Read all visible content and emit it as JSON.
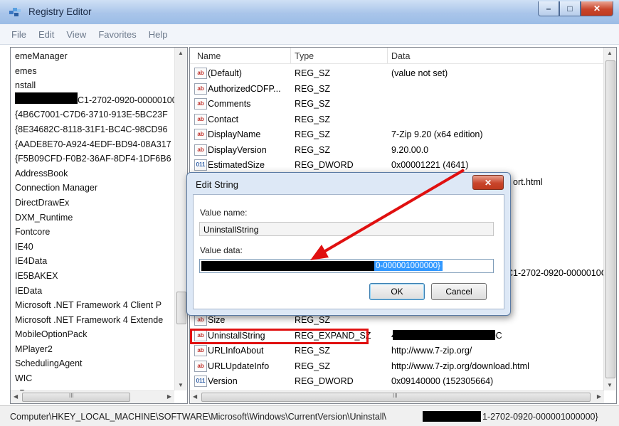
{
  "window": {
    "title": "Registry Editor",
    "min_glyph": "–",
    "max_glyph": "□",
    "close_glyph": "✕"
  },
  "menu": [
    "File",
    "Edit",
    "View",
    "Favorites",
    "Help"
  ],
  "tree": {
    "items": [
      "emeManager",
      "emes",
      "nstall",
      "C1-2702-0920-00000100",
      "{4B6C7001-C7D6-3710-913E-5BC23F",
      "{8E34682C-8118-31F1-BC4C-98CD96",
      "{AADE8E70-A924-4EDF-BD94-08A317",
      "{F5B09CFD-F0B2-36AF-8DF4-1DF6B6",
      "AddressBook",
      "Connection Manager",
      "DirectDrawEx",
      "DXM_Runtime",
      "Fontcore",
      "IE40",
      "IE4Data",
      "IE5BAKEX",
      "IEData",
      "Microsoft .NET Framework 4 Client P",
      "Microsoft .NET Framework 4 Extende",
      "MobileOptionPack",
      "MPlayer2",
      "SchedulingAgent",
      "WIC",
      "xP"
    ],
    "hscroll_glyph": "III"
  },
  "list": {
    "columns": [
      "Name",
      "Type",
      "Data"
    ],
    "rows": [
      {
        "icon": "ab",
        "name": "(Default)",
        "type": "REG_SZ",
        "data": "(value not set)"
      },
      {
        "icon": "ab",
        "name": "AuthorizedCDFP...",
        "type": "REG_SZ",
        "data": ""
      },
      {
        "icon": "ab",
        "name": "Comments",
        "type": "REG_SZ",
        "data": ""
      },
      {
        "icon": "ab",
        "name": "Contact",
        "type": "REG_SZ",
        "data": ""
      },
      {
        "icon": "ab",
        "name": "DisplayName",
        "type": "REG_SZ",
        "data": "7-Zip 9.20 (x64 edition)"
      },
      {
        "icon": "ab",
        "name": "DisplayVersion",
        "type": "REG_SZ",
        "data": "9.20.00.0"
      },
      {
        "icon": "011",
        "name": "EstimatedSize",
        "type": "REG_DWORD",
        "data": "0x00001221 (4641)"
      }
    ],
    "partial_right": {
      "row8": "ort.html",
      "row14": "C1-2702-0920-0000010C"
    },
    "bottom_rows": [
      {
        "icon": "ab",
        "name": "Size",
        "type": "REG_SZ",
        "data": ""
      },
      {
        "icon": "ab",
        "name": "UninstallString",
        "type": "REG_EXPAND_SZ",
        "data": "40C1-2702-0920-0000010C"
      },
      {
        "icon": "ab",
        "name": "URLInfoAbout",
        "type": "REG_SZ",
        "data": "http://www.7-zip.org/"
      },
      {
        "icon": "ab",
        "name": "URLUpdateInfo",
        "type": "REG_SZ",
        "data": "http://www.7-zip.org/download.html"
      },
      {
        "icon": "011",
        "name": "Version",
        "type": "REG_DWORD",
        "data": "0x09140000 (152305664)"
      }
    ],
    "hscroll_glyph": "III"
  },
  "dialog": {
    "title": "Edit String",
    "close_glyph": "✕",
    "value_name_label": "Value name:",
    "value_name": "UninstallString",
    "value_data_label": "Value data:",
    "value_data_visible": "0-000001000000}",
    "ok_label": "OK",
    "cancel_label": "Cancel"
  },
  "status": {
    "path": "Computer\\HKEY_LOCAL_MACHINE\\SOFTWARE\\Microsoft\\Windows\\CurrentVersion\\Uninstall\\",
    "path_tail": "1-2702-0920-000001000000}"
  },
  "colors": {
    "highlight_red": "#e01010",
    "selection_blue": "#3399ff"
  }
}
